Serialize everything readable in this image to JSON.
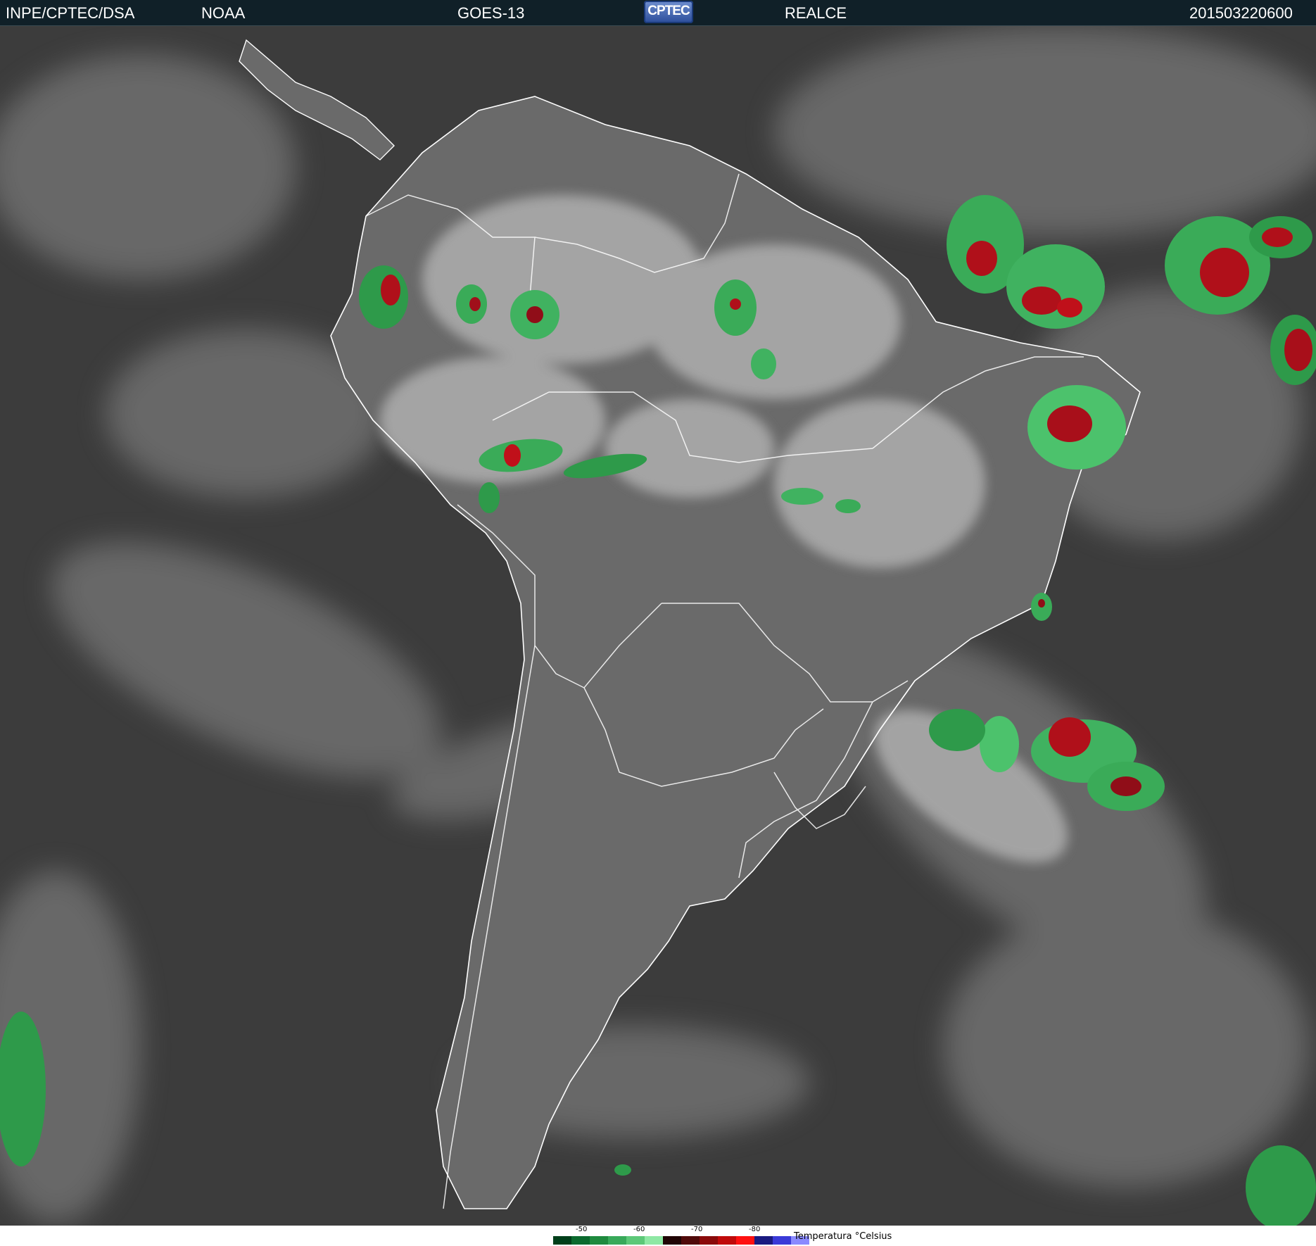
{
  "header": {
    "source": "INPE/CPTEC/DSA",
    "agency": "NOAA",
    "satellite": "GOES-13",
    "logo_text": "CPTEC",
    "product": "REALCE",
    "timestamp": "201503220600"
  },
  "map": {
    "region": "South America",
    "colors": {
      "cloud_free": "#3c3c3c",
      "land": "#606060",
      "cloud_top": "#d8d8d8",
      "borders": "#ffffff"
    }
  },
  "legend": {
    "title": "Temperatura °Celsius",
    "ticks": [
      "-50",
      "-60",
      "-70",
      "-80"
    ],
    "colors": [
      "#003f1a",
      "#0b6a2e",
      "#1e8a3e",
      "#38a95a",
      "#5cc878",
      "#8ee8a4",
      "#200505",
      "#500a0a",
      "#8a0a0a",
      "#c00a0a",
      "#ff1010",
      "#1a1a80",
      "#3a3ad8",
      "#8a8aff"
    ]
  }
}
